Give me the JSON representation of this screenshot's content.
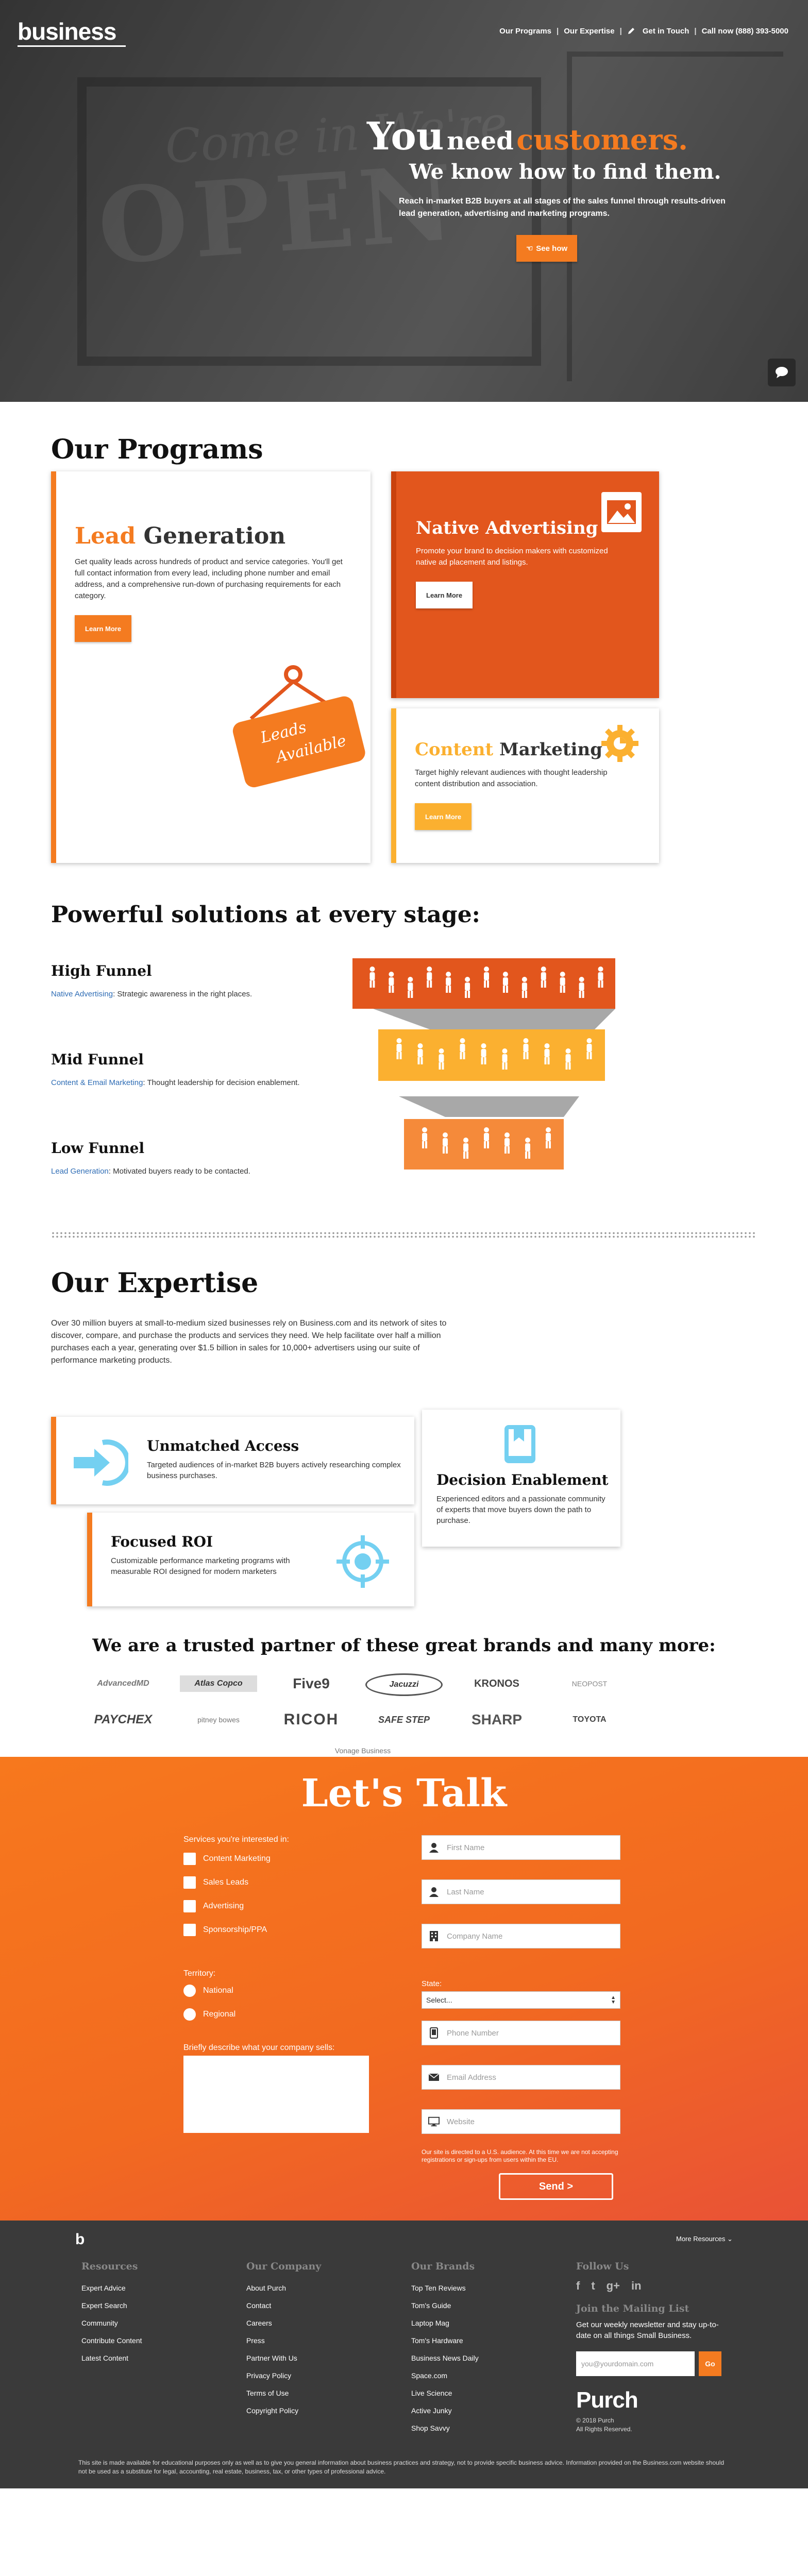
{
  "nav": {
    "logo": "business",
    "links": [
      "Our Programs",
      "Our Expertise",
      "Get in Touch",
      "Call now (888) 393-5000"
    ]
  },
  "hero": {
    "you": "You",
    "need": "need",
    "customers": "customers.",
    "subtitle": "We know how to find them.",
    "body": "Reach in-market B2B buyers at all stages of the sales funnel through results-driven lead generation, advertising and marketing programs.",
    "cta": "See how",
    "sign_top": "Come in We're",
    "sign_main": "OPEN"
  },
  "programs": {
    "title": "Our Programs",
    "lead": {
      "title_accent": "Lead",
      "title_rest": "Generation",
      "body": "Get quality leads across hundreds of product and service categories. You'll get full contact information from every lead, including phone number and email address, and a comprehensive run-down of purchasing requirements for each category.",
      "button": "Learn More",
      "sign_text_1": "Leads",
      "sign_text_2": "Available"
    },
    "native": {
      "title": "Native Advertising",
      "body": "Promote your brand to decision makers with customized native ad placement and listings.",
      "button": "Learn More"
    },
    "content": {
      "title_accent": "Content",
      "title_rest": "Marketing",
      "body": "Target highly relevant audiences with thought leadership content distribution and association.",
      "button": "Learn More"
    }
  },
  "funnel": {
    "title": "Powerful solutions at every stage:",
    "stages": [
      {
        "title": "High Funnel",
        "link": "Native Advertising",
        "desc": ": Strategic awareness in the right places."
      },
      {
        "title": "Mid Funnel",
        "link": "Content & Email Marketing",
        "desc": ": Thought leadership for decision enablement."
      },
      {
        "title": "Low Funnel",
        "link": "Lead Generation",
        "desc": ": Motivated buyers ready to be contacted."
      }
    ],
    "colors": {
      "high": "#e2561d",
      "mid": "#fbb030",
      "low": "#f58a3a",
      "connector": "#a8a8a8"
    }
  },
  "expertise": {
    "title": "Our Expertise",
    "body": "Over 30 million buyers at small-to-medium sized businesses rely on Business.com and its network of sites to discover, compare, and purchase the products and services they need. We help facilitate over half a million purchases each a year, generating over $1.5 billion in sales for 10,000+ advertisers using our suite of performance marketing products.",
    "cards": [
      {
        "title": "Unmatched Access",
        "body": "Targeted audiences of in-market B2B buyers actively researching complex business purchases."
      },
      {
        "title": "Decision Enablement",
        "body": "Experienced editors and a passionate community of experts that move buyers down the path to purchase."
      },
      {
        "title": "Focused ROI",
        "body": "Customizable performance marketing programs with measurable ROI designed for modern marketers"
      }
    ],
    "brands_title": "We are a trusted partner of these great brands and many more:",
    "brands": [
      "AdvancedMD",
      "Atlas Copco",
      "Five9",
      "Jacuzzi",
      "KRONOS",
      "NEOPOST",
      "PAYCHEX",
      "pitney bowes",
      "RICOH",
      "SAFE STEP",
      "SHARP",
      "TOYOTA",
      "Vonage Business"
    ]
  },
  "talk": {
    "title": "Let's Talk",
    "services_label": "Services you're interested in:",
    "services": [
      "Content Marketing",
      "Sales Leads",
      "Advertising",
      "Sponsorship/PPA"
    ],
    "territory_label": "Territory:",
    "territories": [
      "National",
      "Regional"
    ],
    "describe_label": "Briefly describe what your company sells:",
    "fields": {
      "first_name": "First Name",
      "last_name": "Last Name",
      "company": "Company Name",
      "state_label": "State:",
      "state_value": "Select...",
      "phone": "Phone Number",
      "email": "Email Address",
      "website": "Website"
    },
    "disclaimer": "Our site is directed to a U.S. audience. At this time we are not accepting registrations or sign-ups from users within the EU.",
    "send": "Send >"
  },
  "footer": {
    "more_resources": "More Resources",
    "columns": [
      {
        "title": "Resources",
        "items": [
          "Expert Advice",
          "Expert Search",
          "Community",
          "Contribute Content",
          "Latest Content"
        ]
      },
      {
        "title": "Our Company",
        "items": [
          "About Purch",
          "Contact",
          "Careers",
          "Press",
          "Partner With Us",
          "Privacy Policy",
          "Terms of Use",
          "Copyright Policy"
        ]
      },
      {
        "title": "Our Brands",
        "items": [
          "Top Ten Reviews",
          "Tom's Guide",
          "Laptop Mag",
          "Tom's Hardware",
          "Business News Daily",
          "Space.com",
          "Live Science",
          "Active Junky",
          "Shop Savvy"
        ]
      }
    ],
    "follow_title": "Follow Us",
    "social": [
      "f",
      "t",
      "g+",
      "in"
    ],
    "mailing_title": "Join the Mailing List",
    "mailing_body": "Get our weekly newsletter and stay up-to-date on all things Small Business.",
    "mailing_placeholder": "you@yourdomain.com",
    "mailing_button": "Go",
    "brand": "Purch",
    "copyright": "© 2018 Purch",
    "rights": "All Rights Reserved.",
    "legal": "This site is made available for educational purposes only as well as to give you general information about business practices and strategy, not to provide specific business advice. Information provided on the Business.com website should not be used as a substitute for legal, accounting, real estate, business, tax, or other types of professional advice."
  }
}
